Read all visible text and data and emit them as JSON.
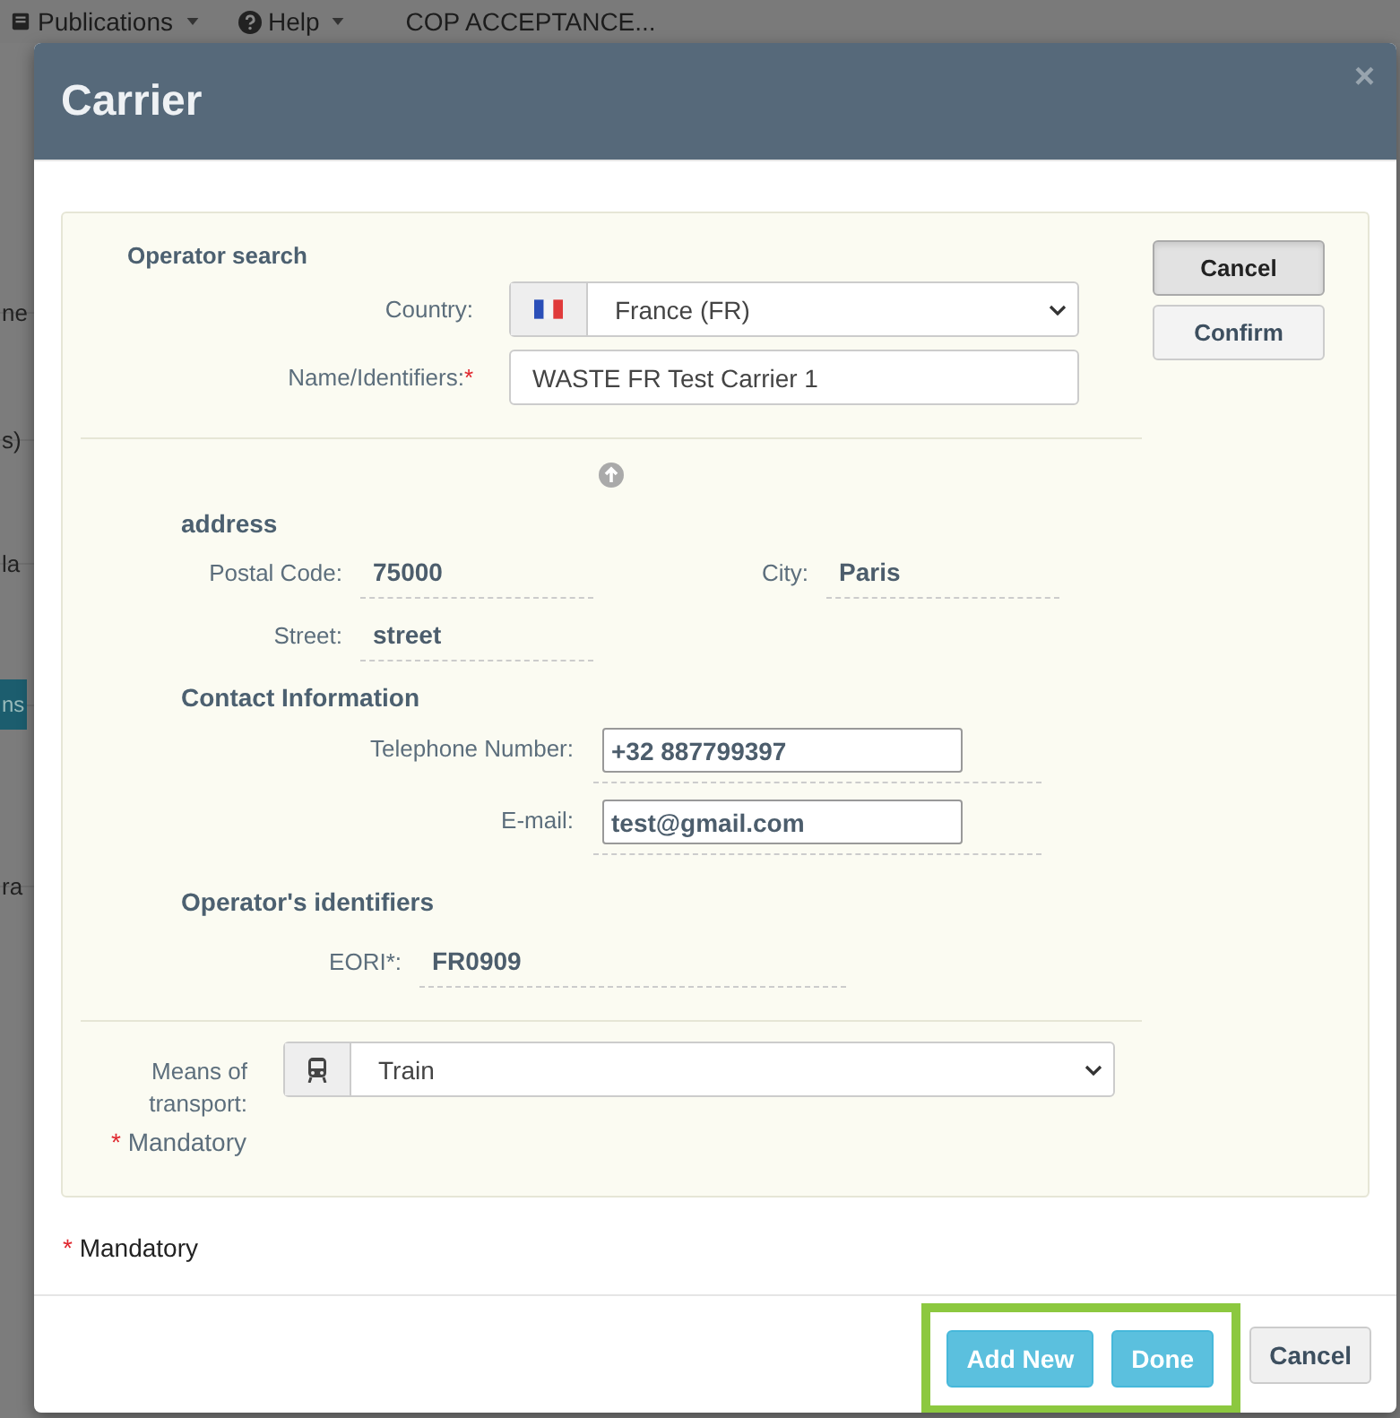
{
  "background": {
    "nav": [
      {
        "label": "Publications",
        "caret": true
      },
      {
        "label": "Help",
        "caret": true
      },
      {
        "label": "COP ACCEPTANCE...",
        "caret": false
      }
    ],
    "fragments": [
      {
        "kind": "text",
        "text": "ne"
      },
      {
        "kind": "text",
        "text": "s)"
      },
      {
        "kind": "text",
        "text": "la"
      },
      {
        "kind": "button",
        "text": "ns"
      },
      {
        "kind": "text",
        "text": "ra"
      }
    ]
  },
  "modal": {
    "title": "Carrier",
    "close": "×",
    "operator_search": {
      "heading": "Operator search",
      "country": {
        "label": "Country:",
        "value": "France (FR)"
      },
      "name": {
        "label": "Name/Identifiers:",
        "required_mark": "*",
        "value": "WASTE FR Test Carrier 1"
      },
      "buttons": [
        {
          "label": "Cancel",
          "selected": true
        },
        {
          "label": "Confirm",
          "selected": false
        }
      ]
    },
    "address": {
      "heading": "address",
      "postal_code": {
        "label": "Postal Code:",
        "value": "75000"
      },
      "city": {
        "label": "City:",
        "value": "Paris"
      },
      "street": {
        "label": "Street:",
        "value": "street"
      }
    },
    "contact": {
      "heading": "Contact Information",
      "telephone": {
        "label": "Telephone Number:",
        "value": "+32 887799397"
      },
      "email": {
        "label": "E-mail:",
        "value": "test@gmail.com"
      }
    },
    "identifiers": {
      "heading": "Operator's identifiers",
      "eori": {
        "label": "EORI*:",
        "value": "FR0909"
      }
    },
    "transport": {
      "label": "Means of transport:",
      "value": "Train"
    },
    "panel_note": {
      "mark": "*",
      "text": "Mandatory"
    },
    "note": {
      "mark": "*",
      "text": "Mandatory"
    },
    "footer": [
      {
        "label": "Add New",
        "kind": "primary",
        "highlighted": true
      },
      {
        "label": "Done",
        "kind": "primary",
        "highlighted": true
      },
      {
        "label": "Cancel",
        "kind": "default",
        "highlighted": false
      }
    ]
  }
}
